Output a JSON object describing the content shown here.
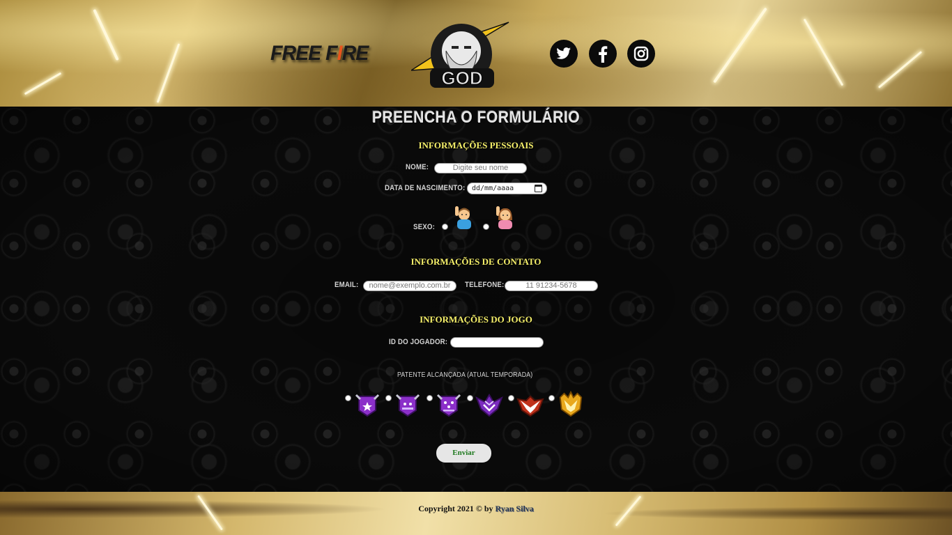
{
  "header": {
    "brand_logo_text": "FREE FIRE",
    "god_logo_text": "GOD",
    "social": [
      {
        "name": "twitter",
        "icon": "twitter-icon"
      },
      {
        "name": "facebook",
        "icon": "facebook-icon"
      },
      {
        "name": "instagram",
        "icon": "instagram-icon"
      }
    ]
  },
  "form": {
    "title": "PREENCHA O FORMULÁRIO",
    "personal": {
      "section_title": "INFORMAÇÕES PESSOAIS",
      "name_label": "NOME:",
      "name_placeholder": "Digite seu nome",
      "birth_label": "DATA DE NASCIMENTO:",
      "birth_placeholder": "dd/mm/aaaa",
      "sex_label": "SEXO:",
      "sex_options": [
        {
          "icon": "man-raising-hand-icon",
          "selected": false
        },
        {
          "icon": "woman-raising-hand-icon",
          "selected": false
        }
      ]
    },
    "contact": {
      "section_title": "INFORMAÇÕES DE CONTATO",
      "email_label": "EMAIL:",
      "email_placeholder": "nome@exemplo.com.br",
      "phone_label": "TELEFONE:",
      "phone_placeholder": "11 91234-5678"
    },
    "game": {
      "section_title": "INFORMAÇÕES DO JOGO",
      "player_id_label": "ID DO JOGADOR:",
      "player_id_value": "",
      "rank_label": "PATENTE ALCANÇADA (ATUAL TEMPORADA)",
      "ranks": [
        {
          "icon": "rank-platinum-1-icon",
          "selected": false
        },
        {
          "icon": "rank-platinum-2-icon",
          "selected": false
        },
        {
          "icon": "rank-platinum-3-icon",
          "selected": false
        },
        {
          "icon": "rank-diamond-icon",
          "selected": false
        },
        {
          "icon": "rank-heroic-icon",
          "selected": false
        },
        {
          "icon": "rank-master-icon",
          "selected": false
        }
      ]
    },
    "submit_label": "Enviar"
  },
  "footer": {
    "copyright": "Copyright 2021 © by",
    "author": "Ryan Silva"
  },
  "colors": {
    "section_title": "#f6f06a",
    "submit_text": "#1f7a1f",
    "rank_purple": "#8b2fc9",
    "rank_red": "#c0321c",
    "rank_gold": "#e9a81c"
  }
}
